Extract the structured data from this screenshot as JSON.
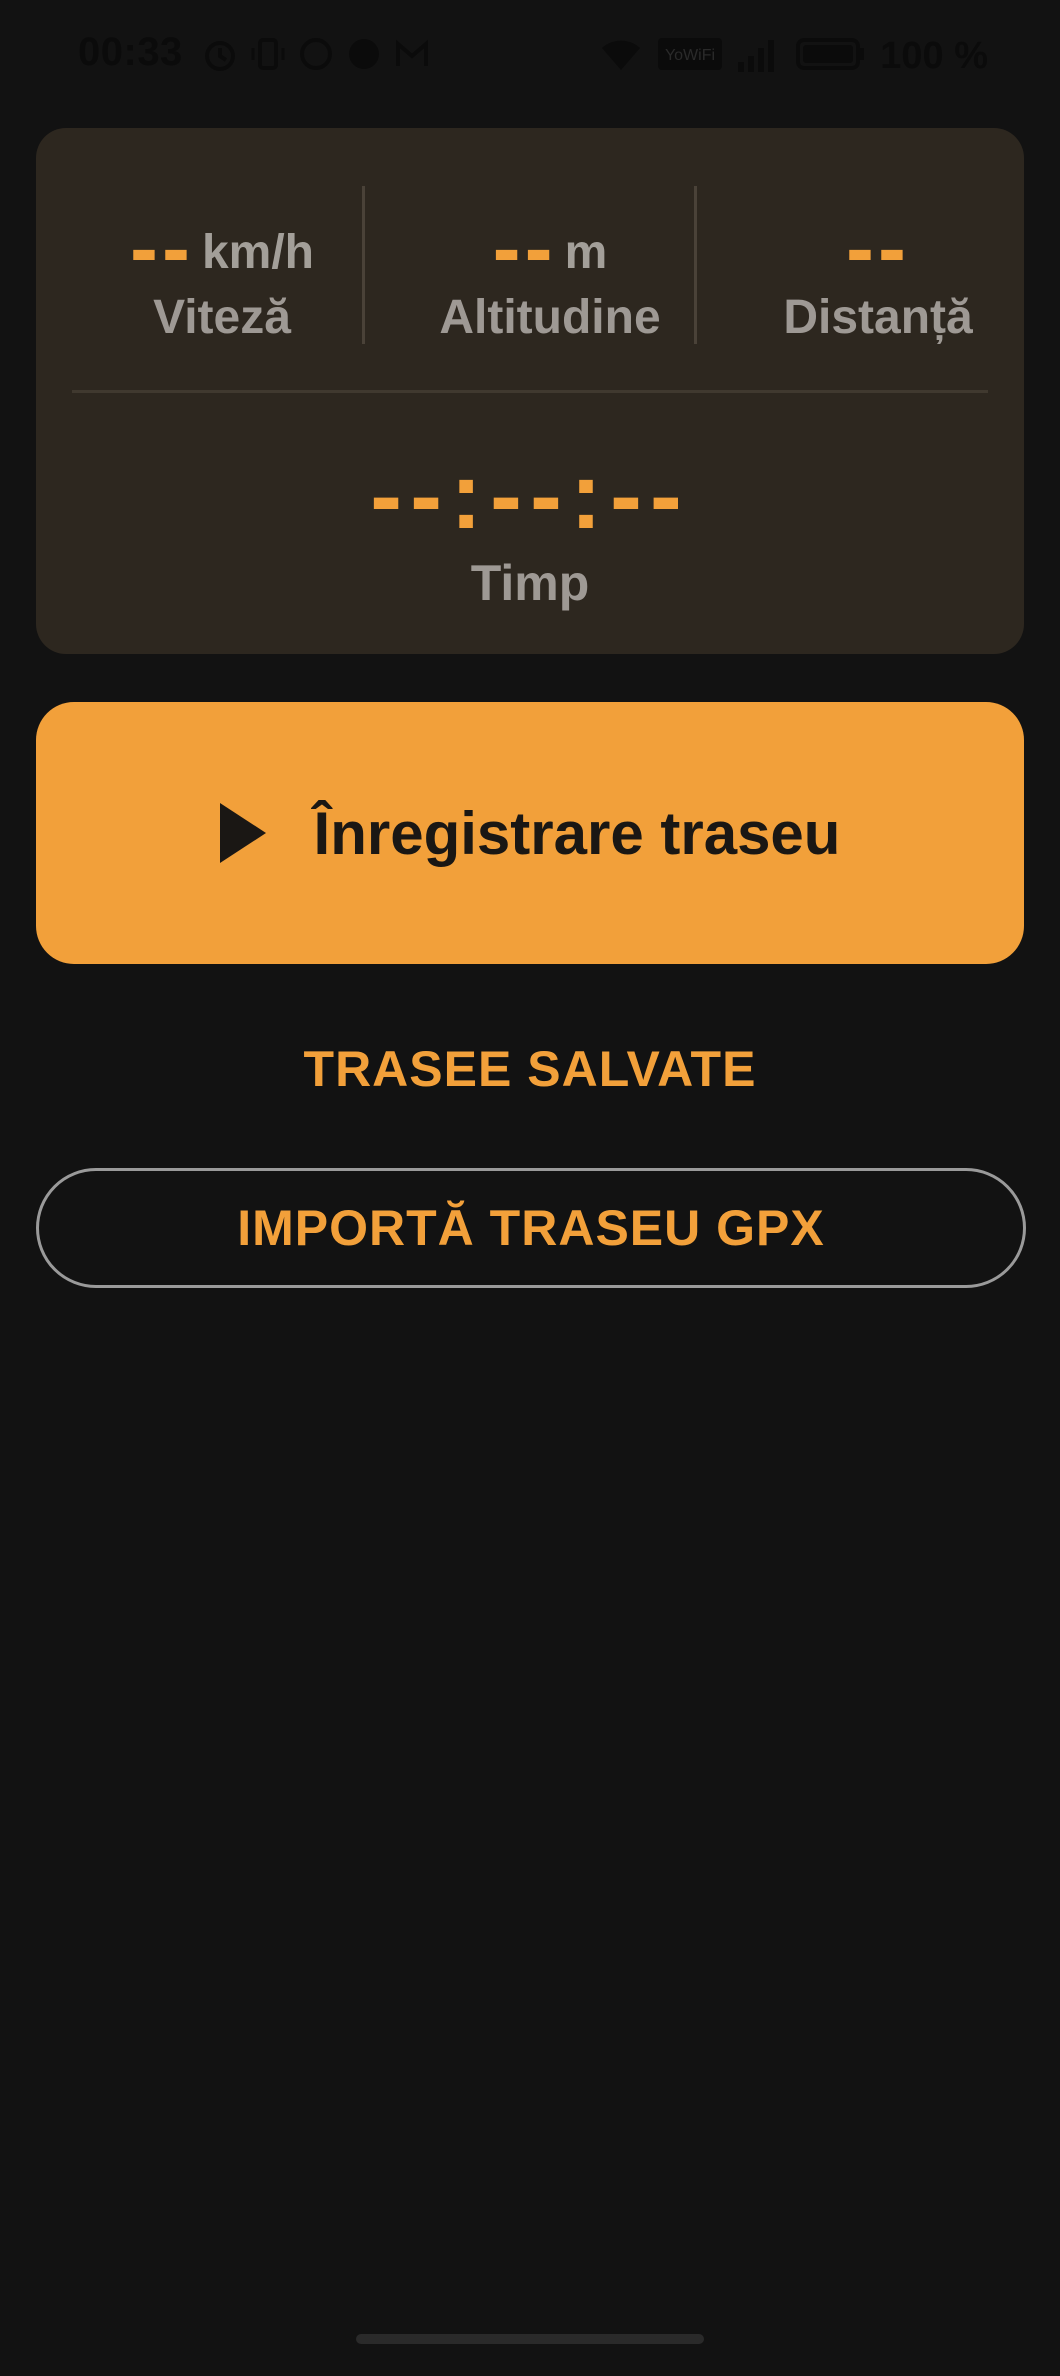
{
  "status_bar": {
    "time": "00:33",
    "battery": "100 %",
    "icons_left": [
      "alarm-icon",
      "vibrate-icon",
      "whatsapp-icon",
      "app-icon",
      "gmail-icon"
    ],
    "icons_right": [
      "wifi-icon",
      "yowifi-badge",
      "signal-icon",
      "battery-charging-icon"
    ],
    "yowifi_text": "YoWiFi"
  },
  "stats": {
    "speed": {
      "value": "--",
      "unit": "km/h",
      "label": "Viteză"
    },
    "altitude": {
      "value": "--",
      "unit": "m",
      "label": "Altitudine"
    },
    "distance": {
      "value": "--",
      "label": "Distanță"
    },
    "time": {
      "value": "--:--:--",
      "label": "Timp"
    }
  },
  "actions": {
    "record_label": "Înregistrare traseu",
    "saved_label": "TRASEE SALVATE",
    "import_label": "IMPORTĂ TRASEU GPX"
  },
  "colors": {
    "accent": "#f2a03a",
    "background": "#121212",
    "card": "#2d271f",
    "muted_text": "#9e9994"
  }
}
